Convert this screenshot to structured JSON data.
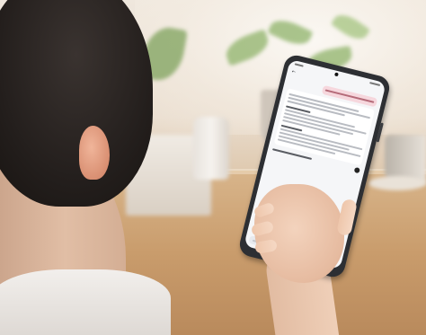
{
  "scene": {
    "description_free": true,
    "palette": {
      "wall": "#efe7dd",
      "table": "#c99c6c",
      "hair": "#231e1c",
      "skin": "#e1bea5",
      "phone_body": "#2d2f33",
      "screen_bg": "#f5f6f8",
      "user_bubble": "#f6d7dd"
    }
  },
  "icons": {
    "back": "arrow-left-icon",
    "send": "send-icon",
    "camera": "camera-icon"
  }
}
